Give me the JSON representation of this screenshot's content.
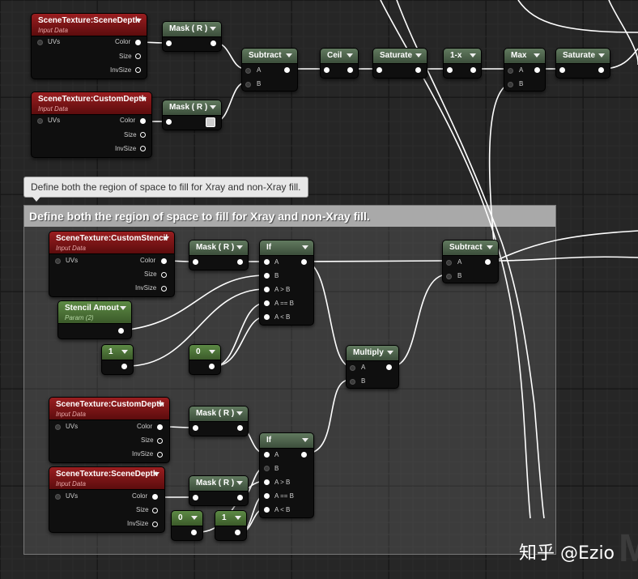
{
  "comment": {
    "tooltip": "Define both the region of space to fill for Xray and non-Xray fill.",
    "title": "Define both the region of space to fill for Xray and non-Xray fill."
  },
  "nodes": {
    "scene_depth_top": {
      "title": "SceneTexture:SceneDepth",
      "subtitle": "Input Data",
      "pin_uvs": "UVs",
      "pin_color": "Color",
      "pin_size": "Size",
      "pin_invsize": "InvSize"
    },
    "custom_depth_top": {
      "title": "SceneTexture:CustomDepth",
      "subtitle": "Input Data",
      "pin_uvs": "UVs",
      "pin_color": "Color",
      "pin_size": "Size",
      "pin_invsize": "InvSize"
    },
    "mask_r_1": {
      "title": "Mask ( R )"
    },
    "mask_r_2": {
      "title": "Mask ( R )"
    },
    "subtract_top": {
      "title": "Subtract",
      "pin_a": "A",
      "pin_b": "B"
    },
    "ceil": {
      "title": "Ceil"
    },
    "saturate_1": {
      "title": "Saturate"
    },
    "one_minus_x": {
      "title": "1-x"
    },
    "max": {
      "title": "Max",
      "pin_a": "A",
      "pin_b": "B"
    },
    "saturate_2": {
      "title": "Saturate"
    },
    "custom_stencil": {
      "title": "SceneTexture:CustomStencil",
      "subtitle": "Input Data",
      "pin_uvs": "UVs",
      "pin_color": "Color",
      "pin_size": "Size",
      "pin_invsize": "InvSize"
    },
    "mask_r_3": {
      "title": "Mask ( R )"
    },
    "if_1": {
      "title": "If",
      "pin_a": "A",
      "pin_b": "B",
      "pin_agb": "A > B",
      "pin_aeb": "A == B",
      "pin_alb": "A < B"
    },
    "stencil_amount": {
      "title": "Stencil Amout",
      "subtitle": "Param (2)"
    },
    "const_1a": {
      "title": "1"
    },
    "const_0a": {
      "title": "0"
    },
    "subtract_bottom": {
      "title": "Subtract",
      "pin_a": "A",
      "pin_b": "B"
    },
    "multiply": {
      "title": "Multiply",
      "pin_a": "A",
      "pin_b": "B"
    },
    "custom_depth_bottom": {
      "title": "SceneTexture:CustomDepth",
      "subtitle": "Input Data",
      "pin_uvs": "UVs",
      "pin_color": "Color",
      "pin_size": "Size",
      "pin_invsize": "InvSize"
    },
    "mask_r_4": {
      "title": "Mask ( R )"
    },
    "if_2": {
      "title": "If",
      "pin_a": "A",
      "pin_b": "B",
      "pin_agb": "A > B",
      "pin_aeb": "A == B",
      "pin_alb": "A < B"
    },
    "scene_depth_bottom": {
      "title": "SceneTexture:SceneDepth",
      "subtitle": "Input Data",
      "pin_uvs": "UVs",
      "pin_color": "Color",
      "pin_size": "Size",
      "pin_invsize": "InvSize"
    },
    "mask_r_5": {
      "title": "Mask ( R )"
    },
    "const_0b": {
      "title": "0"
    },
    "const_1b": {
      "title": "1"
    }
  },
  "watermark": "知乎 @Ezio",
  "background_letter": "M",
  "colors": {
    "grid_bg": "#262626",
    "wire": "#ffffff",
    "red_header": "#8b1a1c",
    "green_header": "#536a51",
    "param_header": "#5d8a45"
  }
}
